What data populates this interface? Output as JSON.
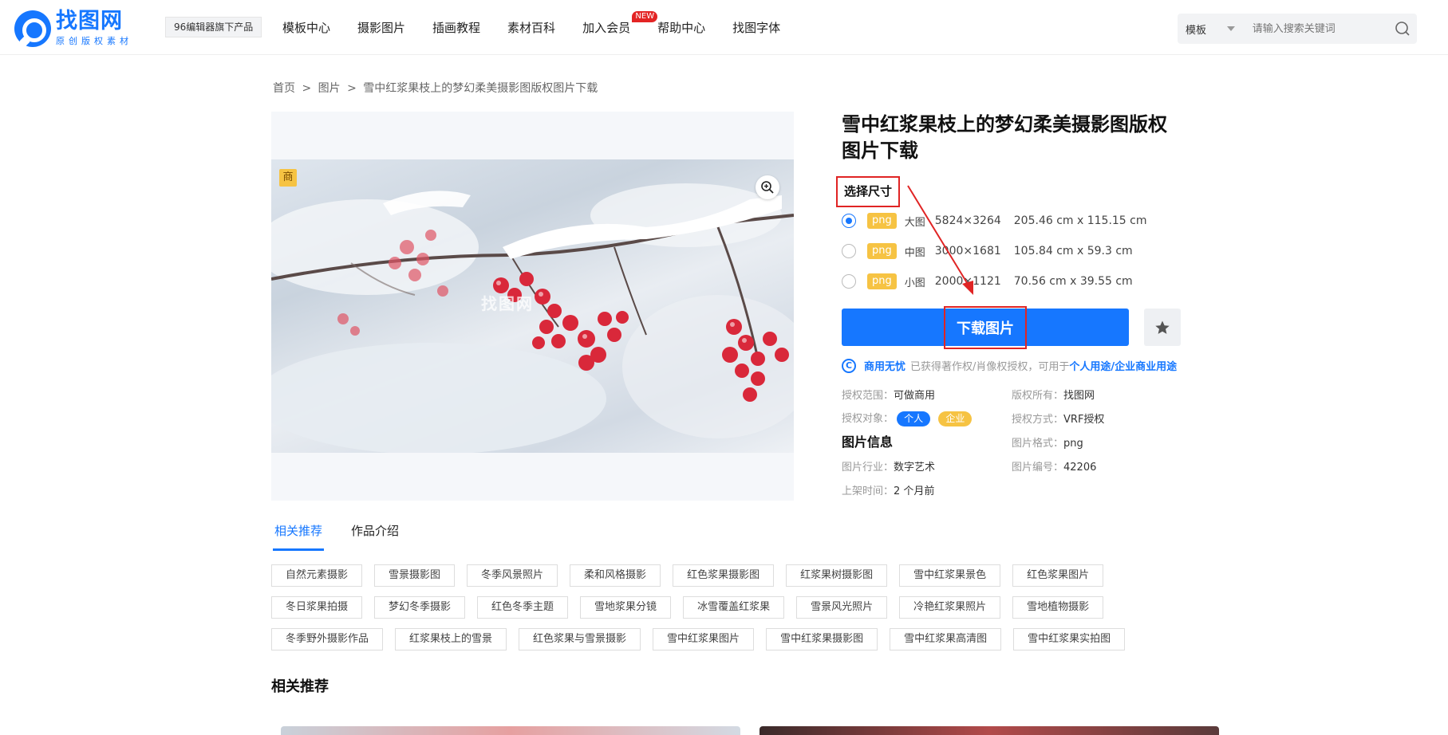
{
  "header": {
    "logo_title": "找图网",
    "logo_sub": "原创版权素材",
    "tag_label": "96编辑器旗下产品",
    "nav": [
      {
        "label": "模板中心"
      },
      {
        "label": "摄影图片"
      },
      {
        "label": "插画教程"
      },
      {
        "label": "素材百科"
      },
      {
        "label": "加入会员",
        "badge": "NEW"
      },
      {
        "label": "帮助中心"
      },
      {
        "label": "找图字体"
      }
    ],
    "search_type": "模板",
    "search_placeholder": "请输入搜索关键词"
  },
  "breadcrumb": [
    "首页",
    ">",
    "图片",
    ">",
    "雪中红浆果枝上的梦幻柔美摄影图版权图片下载"
  ],
  "preview": {
    "badge": "商",
    "watermark": "找图网"
  },
  "detail": {
    "title": "雪中红浆果枝上的梦幻柔美摄影图版权图片下载",
    "size_label": "选择尺寸",
    "sizes": [
      {
        "format": "png",
        "name": "大图",
        "px": "5824×3264",
        "cm": "205.46 cm x 115.15 cm",
        "selected": true
      },
      {
        "format": "png",
        "name": "中图",
        "px": "3000×1681",
        "cm": "105.84 cm x 59.3 cm",
        "selected": false
      },
      {
        "format": "png",
        "name": "小图",
        "px": "2000×1121",
        "cm": "70.56 cm x 39.55 cm",
        "selected": false
      }
    ],
    "download_label": "下载图片",
    "license_icon": "C",
    "license_strong": "商用无忧",
    "license_text": "已获得著作权/肖像权授权，可用于",
    "license_link": "个人用途/企业商业用途",
    "scope_label": "授权范围：",
    "scope_value": "可做商用",
    "owner_label": "版权所有：",
    "owner_value": "找图网",
    "object_label": "授权对象：",
    "object_chip1": "个人",
    "object_chip2": "企业",
    "method_label": "授权方式：",
    "method_value": "VRF授权",
    "info_title": "图片信息",
    "format_label": "图片格式：",
    "format_value": "png",
    "industry_label": "图片行业：",
    "industry_value": "数字艺术",
    "number_label": "图片编号：",
    "number_value": "42206",
    "time_label": "上架时间：",
    "time_value": "2 个月前"
  },
  "tabs": [
    {
      "label": "相关推荐",
      "active": true
    },
    {
      "label": "作品介绍",
      "active": false
    }
  ],
  "keywords": [
    [
      "自然元素摄影",
      "雪景摄影图",
      "冬季风景照片",
      "柔和风格摄影",
      "红色浆果摄影图",
      "红浆果树摄影图",
      "雪中红浆果景色",
      "红色浆果图片"
    ],
    [
      "冬日浆果拍摄",
      "梦幻冬季摄影",
      "红色冬季主题",
      "雪地浆果分镜",
      "冰雪覆盖红浆果",
      "雪景风光照片",
      "冷艳红浆果照片",
      "雪地植物摄影"
    ],
    [
      "冬季野外摄影作品",
      "红浆果枝上的雪景",
      "红色浆果与雪景摄影",
      "雪中红浆果图片",
      "雪中红浆果摄影图",
      "雪中红浆果高清图",
      "雪中红浆果实拍图"
    ]
  ],
  "related_title": "相关推荐",
  "colors": {
    "accent": "#1677ff",
    "badge_yellow": "#f6c343",
    "annotation_red": "#e02424"
  }
}
